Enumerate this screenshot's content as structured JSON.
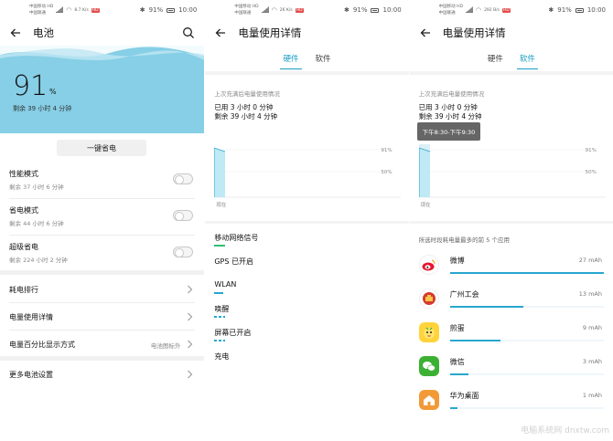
{
  "status_bar": {
    "carrier_1": "中国移动 HD",
    "carrier_2": "中国联通",
    "speed_p1": "8.7 K/s",
    "speed_p2": "26 K/s",
    "speed_p3": "292 B/s",
    "hd": "HD",
    "battery_pct": "91%",
    "time": "10:00"
  },
  "panel1": {
    "title": "电池",
    "battery_level": "91",
    "percent_sign": "%",
    "remaining": "剩余 39 小时 4 分钟",
    "save_button": "一键省电",
    "modes": [
      {
        "title": "性能模式",
        "subtitle": "剩余 37 小时 6 分钟"
      },
      {
        "title": "省电模式",
        "subtitle": "剩余 44 小时 6 分钟"
      },
      {
        "title": "超级省电",
        "subtitle": "剩余 224 小时 2 分钟"
      }
    ],
    "nav": [
      {
        "label": "耗电排行",
        "value": ""
      },
      {
        "label": "电量使用详情",
        "value": ""
      },
      {
        "label": "电量百分比显示方式",
        "value": "电池图标外"
      }
    ],
    "more": "更多电池设置"
  },
  "detail": {
    "title": "电量使用详情",
    "tab_hardware": "硬件",
    "tab_software": "软件",
    "since_title": "上次充满后电量使用情况",
    "used": "已用 3 小时 0 分钟",
    "remaining": "剩余 39 小时 4 分钟",
    "y_label_high": "91%",
    "y_label_mid": "50%",
    "x_label_now": "现在",
    "hardware_items": [
      {
        "label": "移动网络信号",
        "bar_color": "#2fbf71",
        "bar_fraction": 0.06
      },
      {
        "label": "GPS 已开启",
        "bar_color": "",
        "bar_fraction": 0
      },
      {
        "label": "WLAN",
        "bar_color": "#27a7cf",
        "bar_fraction": 0.05
      },
      {
        "label": "唤醒",
        "bar_color": "#27a7cf",
        "bar_fraction": 0.06
      },
      {
        "label": "屏幕已开启",
        "bar_color": "#27a7cf",
        "bar_fraction": 0.06
      },
      {
        "label": "充电",
        "bar_color": "",
        "bar_fraction": 0
      }
    ],
    "tooltip": "下午8:30-下午9:30",
    "apps_title": "所选时段耗电量最多的前 5 个应用",
    "apps": [
      {
        "name": "微博",
        "mah": "27 mAh",
        "fraction": 1.0,
        "icon": "weibo-icon",
        "icon_color": "#ffffff"
      },
      {
        "name": "广州工会",
        "mah": "13 mAh",
        "fraction": 0.48,
        "icon": "guangzhou-union-icon",
        "icon_color": "#d63a2f"
      },
      {
        "name": "煎蛋",
        "mah": "9 mAh",
        "fraction": 0.33,
        "icon": "jiandan-icon",
        "icon_color": "#ffd43b"
      },
      {
        "name": "微信",
        "mah": "3 mAh",
        "fraction": 0.12,
        "icon": "wechat-icon",
        "icon_color": "#3cb034"
      },
      {
        "name": "华为桌面",
        "mah": "1 mAh",
        "fraction": 0.05,
        "icon": "huawei-launcher-icon",
        "icon_color": "#f29a38"
      }
    ]
  },
  "watermark": "电脑系统网 dnxtw.com",
  "colors": {
    "accent": "#1a9ec4",
    "hero": "#86cfe6",
    "bar": "#27a7cf"
  }
}
